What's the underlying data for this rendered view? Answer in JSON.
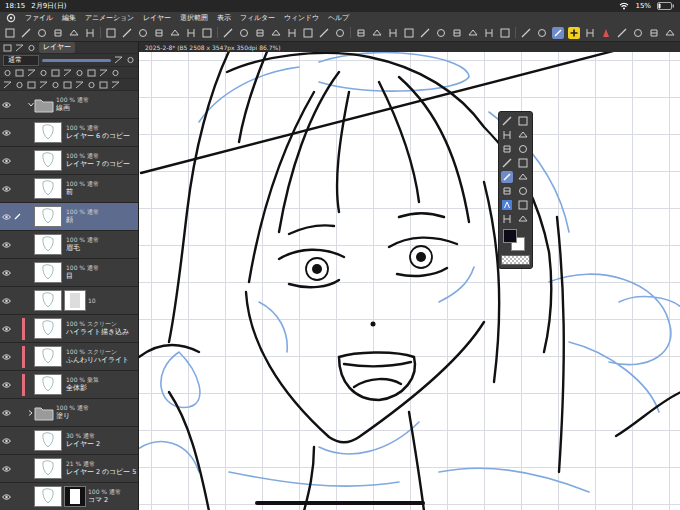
{
  "status_bar": {
    "time": "18:15",
    "date": "2月9日(日)",
    "battery": "15%",
    "battery_level": 0.15
  },
  "menu": [
    "ファイル",
    "編集",
    "アニメーション",
    "レイヤー",
    "選択範囲",
    "表示",
    "フィルター",
    "ウィンドウ",
    "ヘルプ"
  ],
  "document_tab": {
    "title": "2025-2-8* (B5 2508 x 3547px 350dpi 86.7%)"
  },
  "layer_panel": {
    "tab": "レイヤー",
    "blend_mode": "通常"
  },
  "layers": [
    {
      "kind": "folder",
      "opacity": "100 %",
      "blend": "通常",
      "name": "線画",
      "selected": false,
      "visible": true,
      "clipped": false,
      "expanded": true
    },
    {
      "kind": "layer",
      "opacity": "100 %",
      "blend": "通常",
      "name": "レイヤー 6 のコピー",
      "selected": false,
      "visible": true,
      "clipped": false
    },
    {
      "kind": "layer",
      "opacity": "100 %",
      "blend": "通常",
      "name": "レイヤー 7 のコピー",
      "selected": false,
      "visible": true,
      "clipped": false
    },
    {
      "kind": "layer",
      "opacity": "100 %",
      "blend": "通常",
      "name": "前",
      "selected": false,
      "visible": true,
      "clipped": false
    },
    {
      "kind": "layer",
      "opacity": "100 %",
      "blend": "通常",
      "name": "顔",
      "selected": true,
      "visible": true,
      "clipped": false
    },
    {
      "kind": "layer",
      "opacity": "100 %",
      "blend": "通常",
      "name": "眉毛",
      "selected": false,
      "visible": true,
      "clipped": false
    },
    {
      "kind": "layer",
      "opacity": "100 %",
      "blend": "通常",
      "name": "目",
      "selected": false,
      "visible": true,
      "clipped": false
    },
    {
      "kind": "masked",
      "opacity": "10",
      "selected": false,
      "visible": true,
      "clipped": false
    },
    {
      "kind": "layer",
      "opacity": "100 %",
      "blend": "スクリーン",
      "name": "ハイライト描き込み",
      "selected": false,
      "visible": true,
      "clipped": true
    },
    {
      "kind": "layer",
      "opacity": "100 %",
      "blend": "スクリーン",
      "name": "ふんわりハイライト",
      "selected": false,
      "visible": true,
      "clipped": true
    },
    {
      "kind": "layer",
      "opacity": "100 %",
      "blend": "乗算",
      "name": "全体影",
      "selected": false,
      "visible": true,
      "clipped": true
    },
    {
      "kind": "folder",
      "opacity": "100 %",
      "blend": "通常",
      "name": "塗り",
      "selected": false,
      "visible": true,
      "clipped": false,
      "expanded": false
    },
    {
      "kind": "layer",
      "opacity": "30 %",
      "blend": "通常",
      "name": "レイヤー 2",
      "selected": false,
      "visible": true,
      "clipped": false
    },
    {
      "kind": "layer",
      "opacity": "21 %",
      "blend": "通常",
      "name": "レイヤー 2 のコピー 5",
      "selected": false,
      "visible": true,
      "clipped": false
    },
    {
      "kind": "frame",
      "opacity": "100 %",
      "blend": "通常",
      "name": "コマ 2",
      "selected": false,
      "visible": true,
      "clipped": false
    },
    {
      "kind": "layer",
      "opacity": "100 %",
      "blend": "通常",
      "selected": false,
      "visible": true,
      "clipped": false
    }
  ],
  "color_swatches": [
    {
      "color": "#0c0c18",
      "selected": true
    },
    {
      "color": "#ffffff",
      "selected": false
    }
  ]
}
